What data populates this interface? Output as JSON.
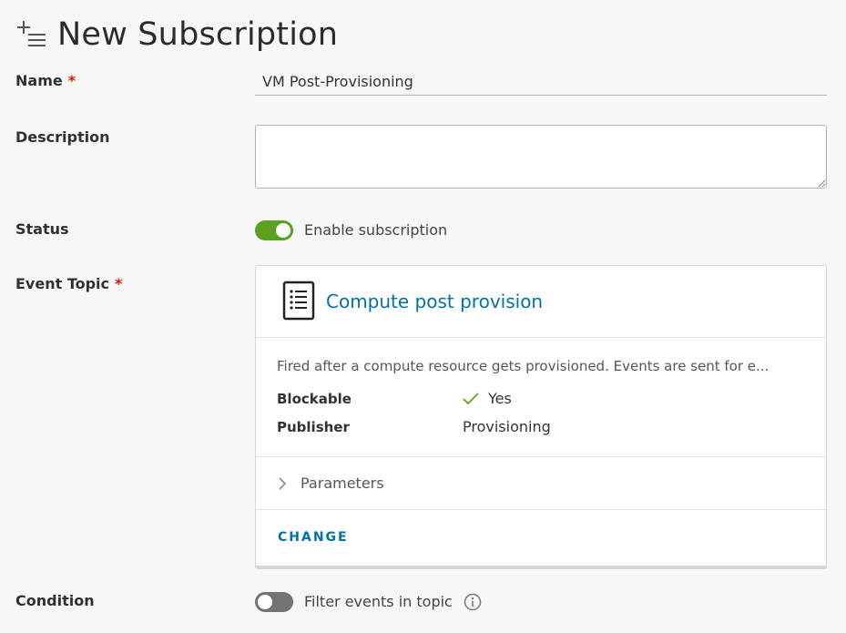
{
  "header": {
    "title": "New Subscription",
    "icon": "add-list-icon"
  },
  "form": {
    "name": {
      "label": "Name",
      "required_mark": "*",
      "value": "VM Post-Provisioning"
    },
    "description": {
      "label": "Description",
      "value": ""
    },
    "status": {
      "label": "Status",
      "toggle_on": true,
      "toggle_label": "Enable subscription"
    },
    "event_topic": {
      "label": "Event Topic",
      "required_mark": "*",
      "topic_name": "Compute post provision",
      "description": "Fired after a compute resource gets provisioned. Events are sent for e...",
      "blockable_label": "Blockable",
      "blockable_value": "Yes",
      "publisher_label": "Publisher",
      "publisher_value": "Provisioning",
      "parameters_label": "Parameters",
      "change_label": "CHANGE"
    },
    "condition": {
      "label": "Condition",
      "toggle_on": false,
      "toggle_label": "Filter events in topic"
    }
  },
  "colors": {
    "accent": "#0072a3",
    "toggle_on": "#5aa220",
    "required": "#c92100",
    "check": "#5aa220"
  }
}
